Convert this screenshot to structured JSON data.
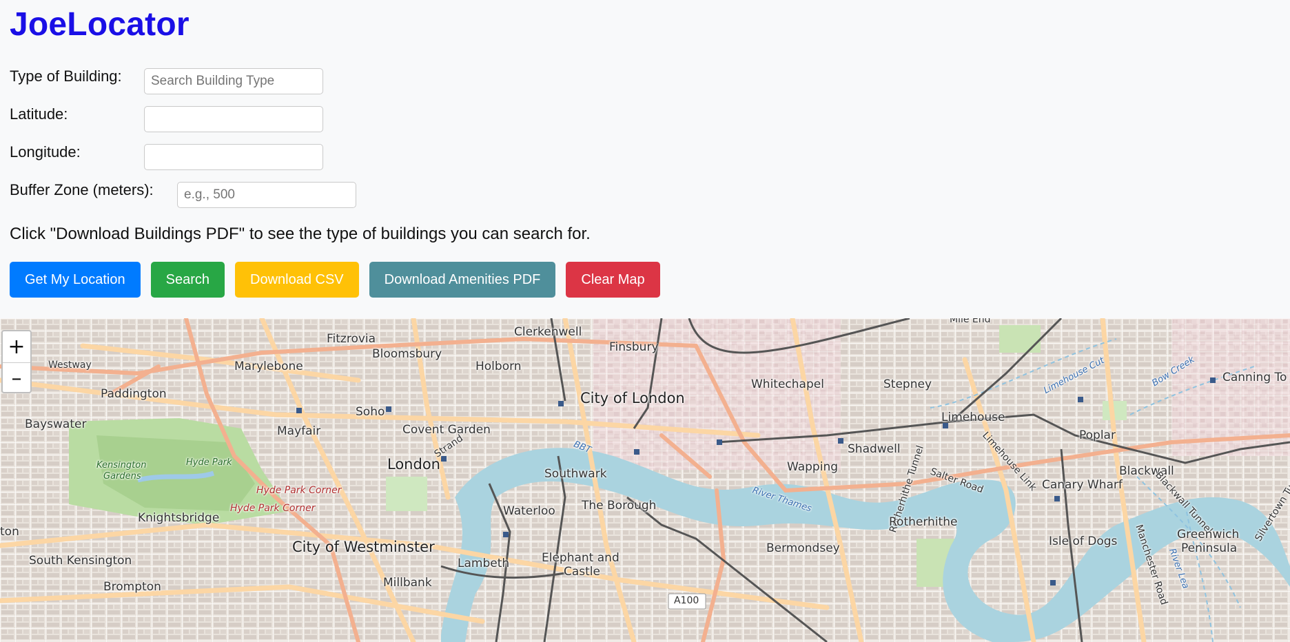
{
  "app": {
    "title": "JoeLocator"
  },
  "form": {
    "building_label": "Type of Building:",
    "building_placeholder": "Search Building Type",
    "building_value": "",
    "latitude_label": "Latitude:",
    "latitude_value": "",
    "longitude_label": "Longitude:",
    "longitude_value": "",
    "buffer_label": "Buffer Zone (meters):",
    "buffer_placeholder": "e.g., 500",
    "buffer_value": ""
  },
  "hint": "Click \"Download Buildings PDF\" to see the type of buildings you can search for.",
  "buttons": {
    "location": "Get My Location",
    "search": "Search",
    "csv": "Download CSV",
    "amenities_pdf": "Download Amenities PDF",
    "clear": "Clear Map"
  },
  "colors": {
    "title": "#1a0fe6",
    "location": "#007bff",
    "search": "#28a745",
    "csv": "#ffc107",
    "amenities_pdf": "#4f8f9b",
    "clear": "#dc3545"
  },
  "map": {
    "zoom_in": "+",
    "zoom_out": "–",
    "labels": {
      "mile_end": "Mile End",
      "fitzrovia": "Fitzrovia",
      "clerkenwell": "Clerkenwell",
      "finsbury": "Finsbury",
      "bloomsbury": "Bloomsbury",
      "marylebone": "Marylebone",
      "holborn": "Holborn",
      "westway": "Westway",
      "whitechapel": "Whitechapel",
      "stepney": "Stepney",
      "canning_town": "Canning To",
      "paddington": "Paddington",
      "city_of_london": "City of London",
      "limehouse": "Limehouse",
      "limehouse_cut": "Limehouse Cut",
      "bow_creek": "Bow Creek",
      "soho": "Soho",
      "bayswater": "Bayswater",
      "mayfair": "Mayfair",
      "covent_garden": "Covent Garden",
      "strand": "Strand",
      "poplar": "Poplar",
      "shadwell": "Shadwell",
      "limehouse_link": "Limehouse Link",
      "kensington_gardens_1": "Kensington",
      "kensington_gardens_2": "Gardens",
      "hyde_park": "Hyde Park",
      "london": "London",
      "southwark": "Southwark",
      "wapping": "Wapping",
      "rotherhithe_tunnel": "Rotherhithe Tunnel",
      "blackwall": "Blackwall",
      "salter_road": "Salter Road",
      "canary_wharf": "Canary Wharf",
      "river_thames": "River Thames",
      "hyde_park_corner_1": "Hyde Park Corner",
      "hyde_park_corner_2": "Hyde Park Corner",
      "blackwall_tunnel": "Blackwall Tunnel",
      "silvertown_tunnel": "Silvertown Tunnel",
      "waterloo": "Waterloo",
      "the_borough": "The Borough",
      "knightsbridge": "Knightsbridge",
      "rotherhithe": "Rotherhithe",
      "greenwich_1": "Greenwich",
      "greenwich_2": "Peninsula",
      "ton": "ton",
      "city_of_westminster": "City of Westminster",
      "bermondsey": "Bermondsey",
      "isle_of_dogs": "Isle of Dogs",
      "manchester_road": "Manchester Road",
      "river_lea": "River Lea",
      "a100": "A100",
      "south_kensington": "South Kensington",
      "lambeth": "Lambeth",
      "elephant_1": "Elephant and",
      "elephant_2": "Castle",
      "millbank": "Millbank",
      "brompton": "Brompton",
      "bbt": "BBT"
    }
  }
}
